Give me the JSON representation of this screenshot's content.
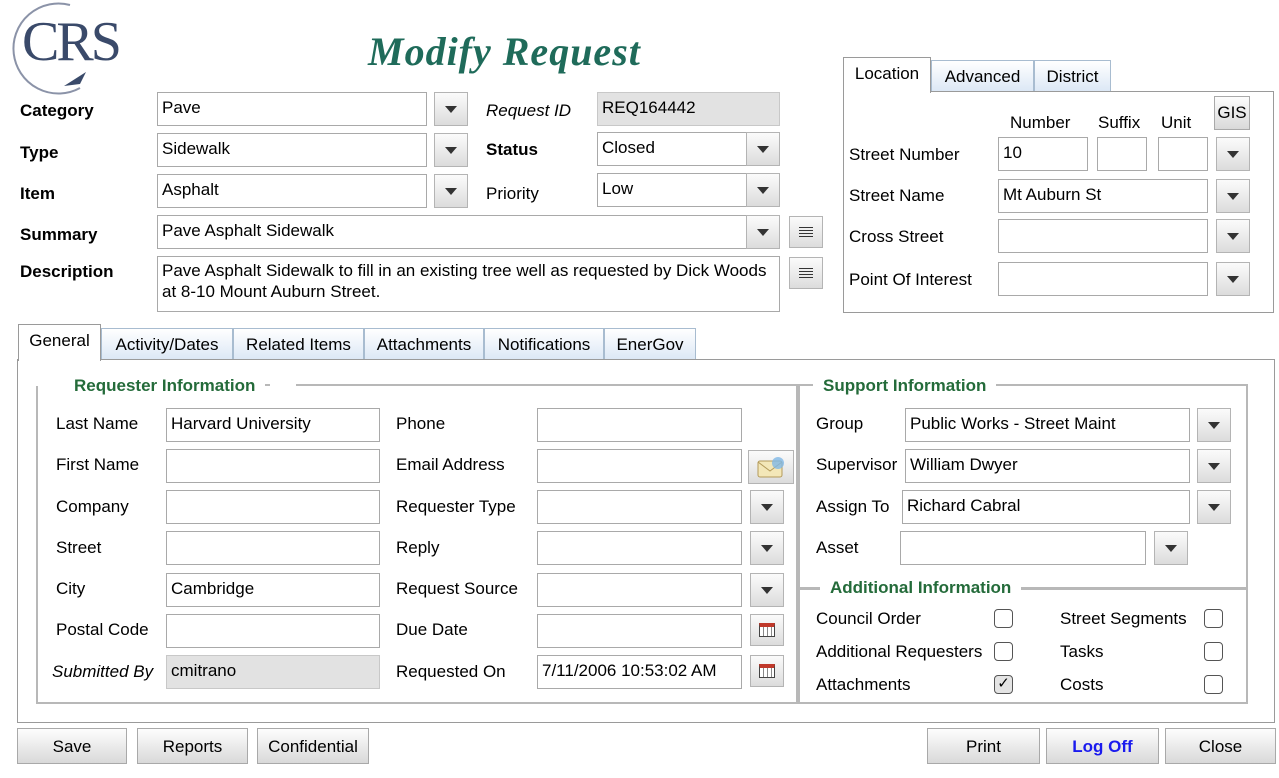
{
  "logo": {
    "text": "CRS"
  },
  "page_title": "Modify Request",
  "request": {
    "category": {
      "label": "Category",
      "value": "Pave"
    },
    "type": {
      "label": "Type",
      "value": "Sidewalk"
    },
    "item": {
      "label": "Item",
      "value": "Asphalt"
    },
    "summary": {
      "label": "Summary",
      "value": "Pave Asphalt Sidewalk"
    },
    "description": {
      "label": "Description",
      "value": "Pave Asphalt Sidewalk to fill in an existing tree well as requested by Dick Woods at 8-10 Mount Auburn Street."
    },
    "request_id": {
      "label": "Request ID",
      "value": "REQ164442"
    },
    "status": {
      "label": "Status",
      "value": "Closed"
    },
    "priority": {
      "label": "Priority",
      "value": "Low"
    }
  },
  "location": {
    "tabs": [
      "Location",
      "Advanced",
      "District"
    ],
    "col_number": "Number",
    "col_suffix": "Suffix",
    "col_unit": "Unit",
    "gis_label": "GIS",
    "street_number": {
      "label": "Street Number",
      "number": "10",
      "suffix": "",
      "unit": ""
    },
    "street_name": {
      "label": "Street Name",
      "value": "Mt Auburn St"
    },
    "cross_street": {
      "label": "Cross Street",
      "value": ""
    },
    "poi": {
      "label": "Point Of Interest",
      "value": ""
    }
  },
  "tabs": [
    "General",
    "Activity/Dates",
    "Related Items",
    "Attachments",
    "Notifications",
    "EnerGov"
  ],
  "requester": {
    "title": "Requester Information",
    "last_name": {
      "label": "Last Name",
      "value": "Harvard University"
    },
    "first_name": {
      "label": "First Name",
      "value": ""
    },
    "company": {
      "label": "Company",
      "value": ""
    },
    "street": {
      "label": "Street",
      "value": ""
    },
    "city": {
      "label": "City",
      "value": "Cambridge"
    },
    "postal_code": {
      "label": "Postal Code",
      "value": ""
    },
    "submitted_by": {
      "label": "Submitted By",
      "value": "cmitrano"
    },
    "phone": {
      "label": "Phone",
      "value": ""
    },
    "email": {
      "label": "Email Address",
      "value": ""
    },
    "requester_type": {
      "label": "Requester Type",
      "value": ""
    },
    "reply": {
      "label": "Reply",
      "value": ""
    },
    "request_source": {
      "label": "Request Source",
      "value": ""
    },
    "due_date": {
      "label": "Due Date",
      "value": ""
    },
    "requested_on": {
      "label": "Requested On",
      "value": "7/11/2006 10:53:02 AM"
    }
  },
  "support": {
    "title": "Support Information",
    "group": {
      "label": "Group",
      "value": "Public Works - Street Maint"
    },
    "supervisor": {
      "label": "Supervisor",
      "value": "William Dwyer"
    },
    "assign_to": {
      "label": "Assign To",
      "value": "Richard Cabral"
    },
    "asset": {
      "label": "Asset",
      "value": ""
    }
  },
  "additional": {
    "title": "Additional Information",
    "council_order": {
      "label": "Council Order",
      "checked": false
    },
    "additional_requesters": {
      "label": "Additional Requesters",
      "checked": false
    },
    "attachments": {
      "label": "Attachments",
      "checked": true
    },
    "street_segments": {
      "label": "Street Segments",
      "checked": false
    },
    "tasks": {
      "label": "Tasks",
      "checked": false
    },
    "costs": {
      "label": "Costs",
      "checked": false
    }
  },
  "buttons": {
    "save": "Save",
    "reports": "Reports",
    "confidential": "Confidential",
    "print": "Print",
    "log_off": "Log Off",
    "close": "Close"
  },
  "colors": {
    "title": "#1f6b5a",
    "group_title": "#246b3a",
    "log_off": "#1a1aee",
    "tab_bg": "#dbe7f5"
  }
}
